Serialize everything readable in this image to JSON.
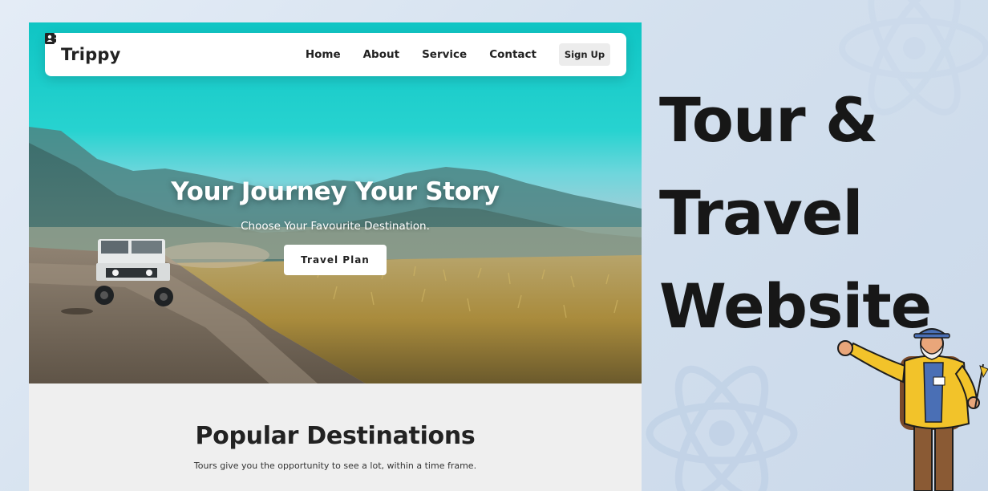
{
  "site": {
    "brand": "Trippy",
    "nav": {
      "items": [
        {
          "label": "Home",
          "icon": "home-icon"
        },
        {
          "label": "About",
          "icon": "info-icon"
        },
        {
          "label": "Service",
          "icon": "briefcase-icon"
        },
        {
          "label": "Contact",
          "icon": "contact-card-icon"
        }
      ],
      "signup_label": "Sign Up"
    },
    "hero": {
      "title": "Your Journey Your Story",
      "subtitle": "Choose Your Favourite Destination.",
      "cta_label": "Travel Plan"
    },
    "destinations": {
      "title": "Popular Destinations",
      "subtitle": "Tours give you the opportunity to see a lot, within a time frame."
    }
  },
  "headline": {
    "lines": [
      "Tour &",
      "Travel",
      "Website"
    ]
  },
  "colors": {
    "sky": "#0fc5c4",
    "text_dark": "#171717",
    "background": "#d3e0ee",
    "jacket": "#f2c32a"
  },
  "decor": {
    "atom_icon": "react-atom-icon",
    "character": "traveller-illustration"
  }
}
